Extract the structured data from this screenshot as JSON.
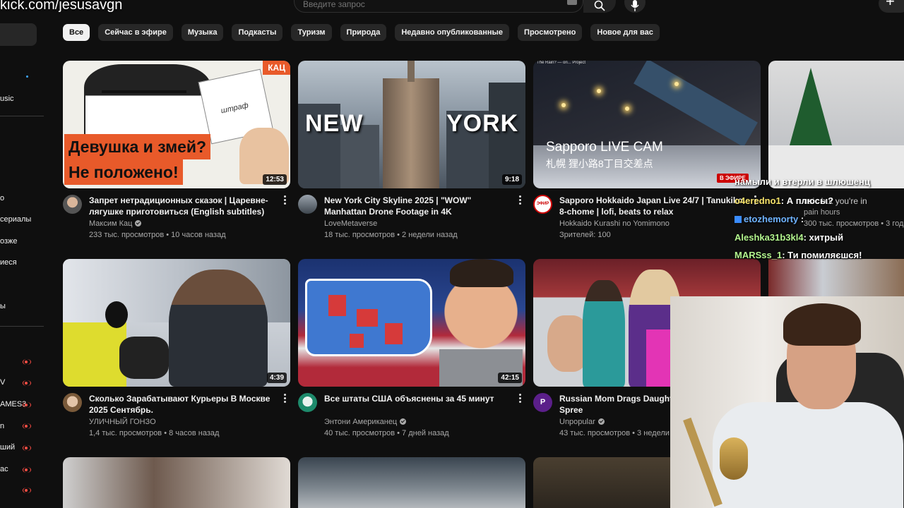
{
  "watermark": "kick.com/jesusavgn",
  "search": {
    "placeholder": "Введите запрос"
  },
  "sidebar": {
    "items": [
      {
        "label": "usic"
      },
      {
        "label": "о"
      },
      {
        "label": "сериалы"
      },
      {
        "label": "озже"
      },
      {
        "label": "иеся"
      },
      {
        "label": "ы"
      },
      {
        "label": ""
      },
      {
        "label": "V"
      },
      {
        "label": "AMES3"
      },
      {
        "label": "n"
      },
      {
        "label": "ший"
      },
      {
        "label": "ас"
      },
      {
        "label": ""
      }
    ]
  },
  "chips": [
    {
      "label": "Все",
      "active": true
    },
    {
      "label": "Сейчас в эфире"
    },
    {
      "label": "Музыка"
    },
    {
      "label": "Подкасты"
    },
    {
      "label": "Туризм"
    },
    {
      "label": "Природа"
    },
    {
      "label": "Недавно опубликованные"
    },
    {
      "label": "Просмотрено"
    },
    {
      "label": "Новое для вас"
    }
  ],
  "videos": [
    {
      "title": "Запрет нетрадиционных сказок | Царевне-лягушке приготовиться (English subtitles)",
      "channel": "Максим Кац",
      "verified": true,
      "stats": "233 тыс. просмотров • 10 часов назад",
      "duration": "12:53",
      "thumb_badge": "КАЦ",
      "thumb_line1": "Девушка и змей?",
      "thumb_line2": "Не положено!",
      "thumb_paper": "штраф"
    },
    {
      "title": "New York City Skyline 2025 | \"WOW\" Manhattan Drone Footage in 4K",
      "channel": "LoveMetaverse",
      "stats": "18 тыс. просмотров • 2 недели назад",
      "duration": "9:18",
      "thumb_word1": "NEW",
      "thumb_word2": "YORK"
    },
    {
      "title": "Sapporo Hokkaido Japan Live 24/7 | Tanukiko 8-chome | lofi, beats to relax",
      "channel": "Hokkaido Kurashi no Yomimono",
      "stats": "Зрителей: 100",
      "thumb_title": "Sapporo LIVE CAM",
      "thumb_sub": "札幌 狸小路8丁目交差点",
      "thumb_small": "The Rain? — ori... Project",
      "live_badge": "В ЭФИРЕ",
      "avatar_text": "ЭФИР"
    },
    {
      "title": "Сколько Зарабатывают Курьеры В Москве 2025 Сентябрь.",
      "channel": "УЛИЧНЫЙ ГОНЗО",
      "stats": "1,4 тыс. просмотров • 8 часов назад",
      "duration": "4:39"
    },
    {
      "title": "Все штаты США объяснены за 45 минут",
      "channel": "Энтони Американец",
      "verified": true,
      "stats": "40 тыс. просмотров • 7 дней назад",
      "duration": "42:15"
    },
    {
      "title": "Russian Mom Drags Daughter Shoplifting Spree",
      "channel": "Unpopular",
      "verified": true,
      "stats": "43 тыс. просмотров • 3 недели",
      "avatar_text": "P"
    }
  ],
  "side_card": {
    "title": "usic but you're in",
    "channel": "pain hours",
    "stats": "300 тыс. просмотров • 3 года н"
  },
  "chat": [
    {
      "user": "",
      "text": "намыли и втерли в шлюшенц"
    },
    {
      "user": "o4eredno1",
      "text": ": А плюсы?"
    },
    {
      "user": "etozhemorty",
      "text": ":",
      "blue": true
    },
    {
      "user": "Aleshka31b3kl4",
      "text": ": хитрый"
    },
    {
      "user": "MARSss_1",
      "text": ": Ти помиляєшся!"
    }
  ],
  "colors": {
    "bg": "#0f0f0f",
    "chip": "#272727",
    "live": "#ff4e45",
    "accent": "#e85a2a"
  }
}
